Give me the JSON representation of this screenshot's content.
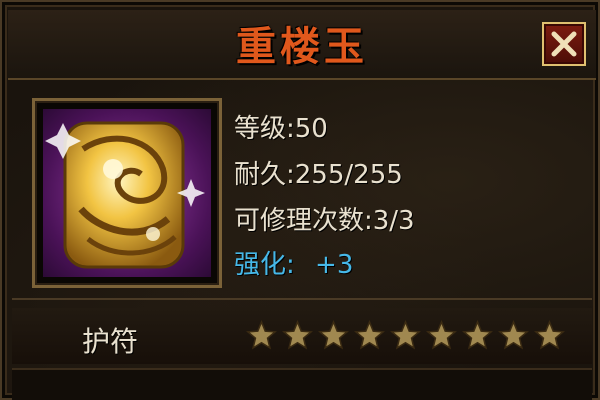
{
  "window": {
    "title": "重楼玉"
  },
  "item": {
    "icon": "jade-pendant-icon",
    "stats": {
      "level": "等级:50",
      "durability": "耐久:255/255",
      "repair_count": "可修理次数:3/3",
      "enhance_label": "强化:",
      "enhance_value": "+3"
    },
    "type": "护符",
    "stars": {
      "filled": 0,
      "total": 9
    }
  },
  "colors": {
    "title": "#e0581c",
    "enhance": "#46b8e8",
    "star": "#a08850",
    "frame": "#7b6238"
  }
}
